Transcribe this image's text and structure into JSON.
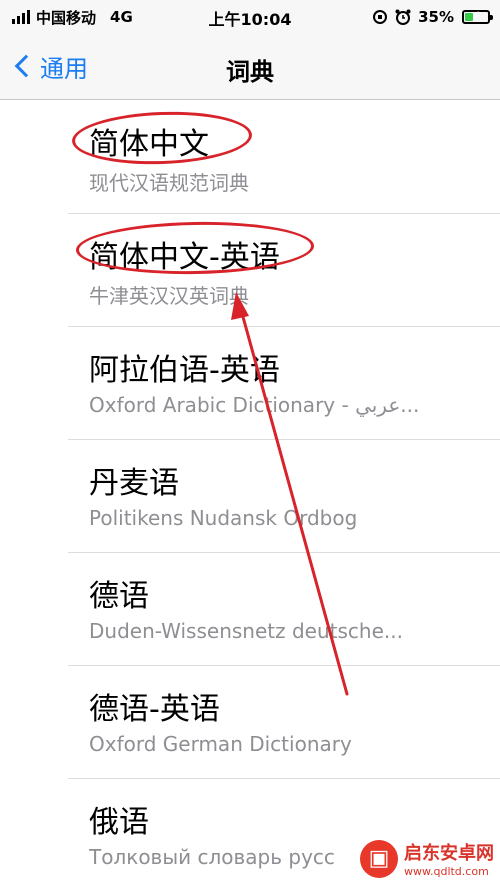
{
  "status_bar": {
    "carrier": "中国移动",
    "network": "4G",
    "time": "上午10:04",
    "battery_percent": "35%",
    "battery_level": 0.35,
    "icons": [
      "signal-icon",
      "orientation-lock-icon",
      "alarm-icon",
      "battery-charging-icon"
    ]
  },
  "nav": {
    "back_label": "通用",
    "title": "词典"
  },
  "dictionaries": [
    {
      "title": "简体中文",
      "subtitle": "现代汉语规范词典"
    },
    {
      "title": "简体中文-英语",
      "subtitle": "牛津英汉汉英词典"
    },
    {
      "title": "阿拉伯语-英语",
      "subtitle": "Oxford Arabic Dictionary - عربي..."
    },
    {
      "title": "丹麦语",
      "subtitle": "Politikens Nudansk Ordbog"
    },
    {
      "title": "德语",
      "subtitle": "Duden-Wissensnetz deutsche..."
    },
    {
      "title": "德语-英语",
      "subtitle": "Oxford German Dictionary"
    },
    {
      "title": "俄语",
      "subtitle": "Толковый словарь русс"
    }
  ],
  "watermark": {
    "main": "启东安卓网",
    "sub": "www.qdltd.com"
  },
  "colors": {
    "accent": "#1a7ef0",
    "annotation": "#d8232a",
    "secondary_text": "#8e8e93"
  }
}
